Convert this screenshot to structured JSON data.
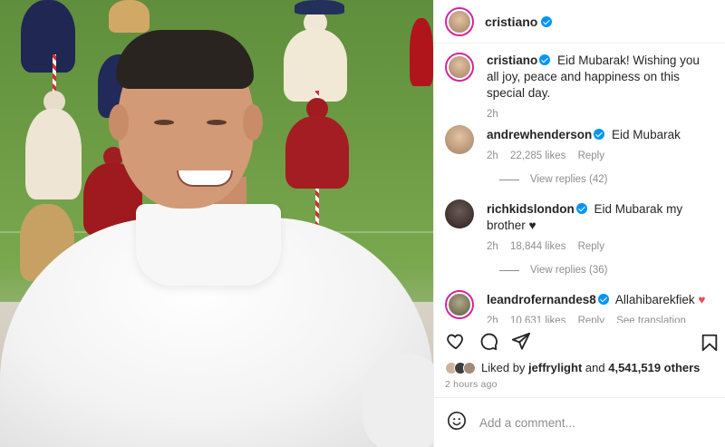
{
  "post": {
    "username": "cristiano",
    "caption_username": "cristiano",
    "caption": "Eid Mubarak! Wishing you all joy, peace and happiness on this special day.",
    "caption_time": "2h"
  },
  "comments": [
    {
      "username": "andrewhenderson",
      "text": "Eid Mubarak",
      "time": "2h",
      "likes": "22,285 likes",
      "reply": "Reply",
      "view_replies": "View replies (42)"
    },
    {
      "username": "richkidslondon",
      "text": "Eid Mubarak my brother",
      "emoji": "♥",
      "time": "2h",
      "likes": "18,844 likes",
      "reply": "Reply",
      "view_replies": "View replies (36)"
    },
    {
      "username": "leandrofernandes8",
      "text": "Allahibarekfiek",
      "emoji": "♥",
      "time": "2h",
      "likes": "10,631 likes",
      "reply": "Reply",
      "translate": "See translation"
    }
  ],
  "likes": {
    "prefix": "Liked by",
    "user": "jeffrylight",
    "joiner": "and",
    "others": "4,541,519 others"
  },
  "time_ago": "2 hours ago",
  "comment_input": {
    "placeholder": "Add a comment..."
  },
  "colors": {
    "verified": "#0095f6",
    "heart": "#ed4956",
    "muted": "#8e8e8e",
    "text": "#262626"
  },
  "icons": [
    "heart-icon",
    "comment-icon",
    "share-icon",
    "bookmark-icon",
    "emoji-icon",
    "verified-badge-icon"
  ]
}
